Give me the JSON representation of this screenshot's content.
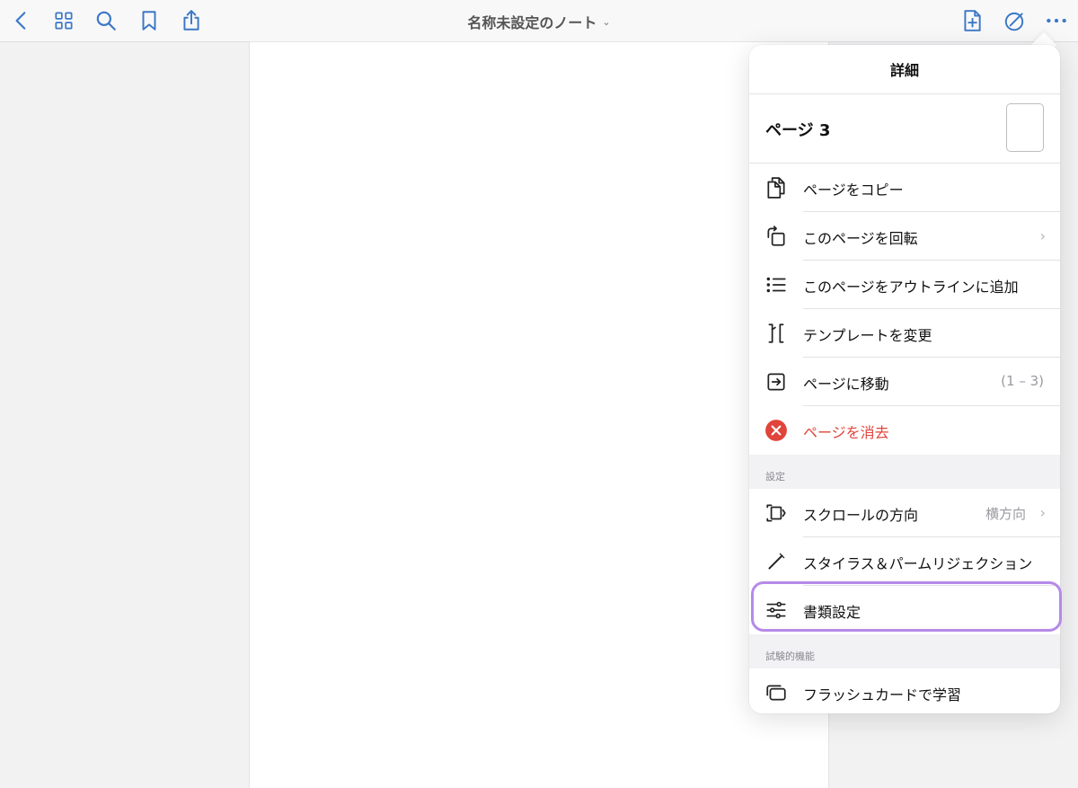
{
  "toolbar": {
    "title": "名称未設定のノート",
    "title_chevron": "⌄",
    "accent": "#3b78c6"
  },
  "popover": {
    "header": "詳細",
    "page_label": "ページ 3",
    "actions": [
      {
        "label": "ページをコピー",
        "icon": "copy-page-icon"
      },
      {
        "label": "このページを回転",
        "icon": "rotate-page-icon",
        "arrow": "›"
      },
      {
        "label": "このページをアウトラインに追加",
        "icon": "outline-list-icon"
      },
      {
        "label": "テンプレートを変更",
        "icon": "template-icon"
      },
      {
        "label": "ページに移動",
        "icon": "go-to-page-icon",
        "value": "(1 – 3)"
      },
      {
        "label": "ページを消去",
        "icon": "delete-icon",
        "color": "#e0443a"
      }
    ],
    "settings_section": "設定",
    "settings": [
      {
        "label": "スクロールの方向",
        "icon": "scroll-direction-icon",
        "value": "横方向",
        "arrow": "›"
      },
      {
        "label": "スタイラス＆パームリジェクション",
        "icon": "stylus-icon"
      },
      {
        "label": "書類設定",
        "icon": "sliders-icon",
        "highlight_color": "#b68ae8"
      }
    ],
    "experimental_section": "試験的機能",
    "experimental": [
      {
        "label": "フラッシュカードで学習",
        "icon": "flashcards-icon"
      }
    ]
  }
}
